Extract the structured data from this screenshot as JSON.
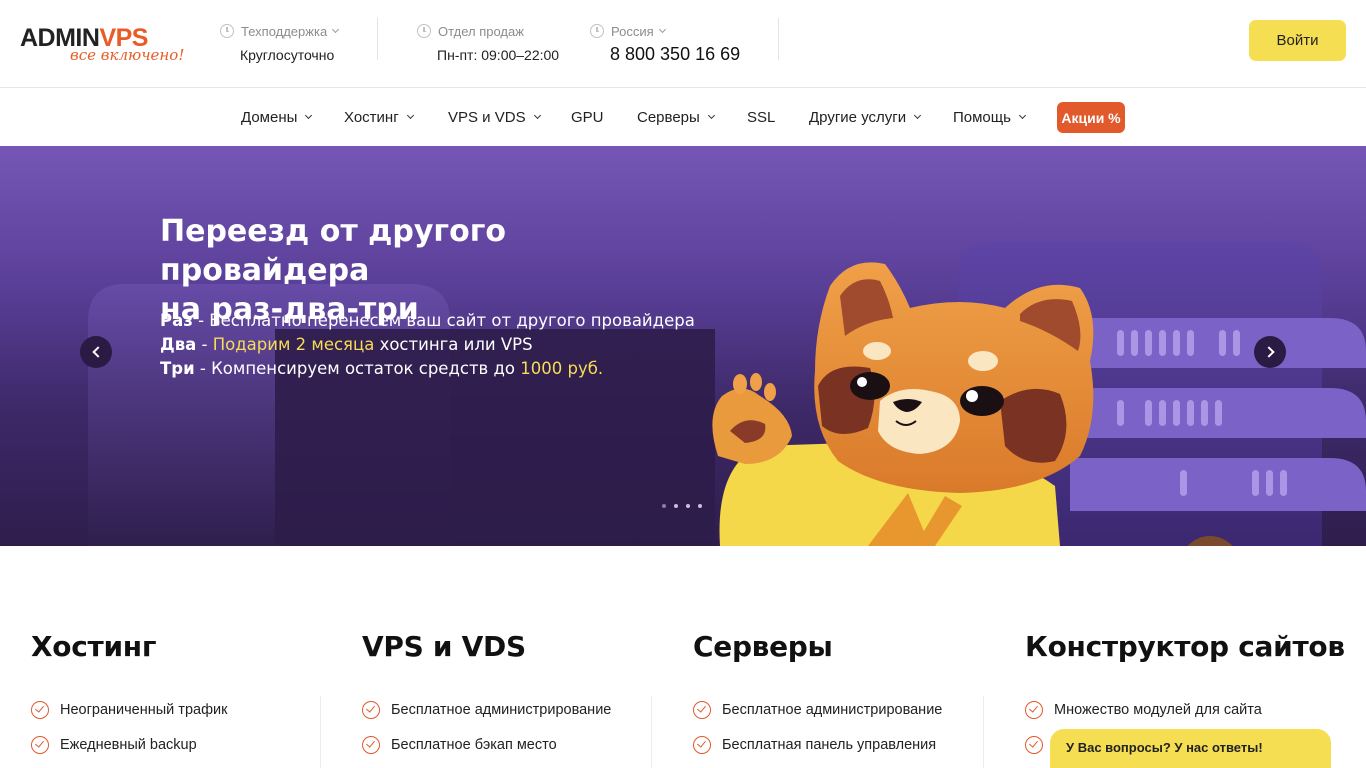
{
  "logo": {
    "brand_left": "ADMIN",
    "brand_right": "VPS",
    "tagline": "все включено!"
  },
  "header": {
    "support": {
      "label": "Техподдержка",
      "value": "Круглосуточно"
    },
    "sales": {
      "label": "Отдел продаж",
      "value": "Пн-пт: 09:00–22:00"
    },
    "region": {
      "label": "Россия",
      "phone": "8 800 350 16 69"
    },
    "login_label": "Войти"
  },
  "nav": {
    "items": [
      {
        "label": "Домены",
        "dropdown": true
      },
      {
        "label": "Хостинг",
        "dropdown": true
      },
      {
        "label": "VPS и VDS",
        "dropdown": true
      },
      {
        "label": "GPU",
        "dropdown": false
      },
      {
        "label": "Серверы",
        "dropdown": true
      },
      {
        "label": "SSL",
        "dropdown": false
      },
      {
        "label": "Другие услуги",
        "dropdown": true
      },
      {
        "label": "Помощь",
        "dropdown": true
      }
    ],
    "promo_label": "Акции %"
  },
  "hero": {
    "title_line1": "Переезд от другого провайдера",
    "title_line2": "на раз-два-три",
    "line1": {
      "lead": "Раз",
      "sep": " - ",
      "text": "Бесплатно перенесем ваш сайт от другого провайдера"
    },
    "line2": {
      "lead": "Два",
      "sep": " - ",
      "highlight": "Подарим 2 месяца",
      "text": " хостинга или VPS"
    },
    "line3": {
      "lead": "Три",
      "sep": " - ",
      "text": "Компенсируем остаток средств до ",
      "highlight": "1000 руб."
    },
    "slides_count": 4,
    "active_slide": 1
  },
  "services": [
    {
      "title": "Хостинг",
      "items": [
        "Неограниченный трафик",
        "Ежедневный backup"
      ]
    },
    {
      "title": "VPS и VDS",
      "items": [
        "Бесплатное администрирование",
        "Бесплатное бэкап место"
      ]
    },
    {
      "title": "Серверы",
      "items": [
        "Бесплатное администрирование",
        "Бесплатная панель управления"
      ]
    },
    {
      "title": "Конструктор сайтов",
      "items": [
        "Множество модулей для сайта",
        ""
      ]
    }
  ],
  "chat": {
    "label": "У Вас вопросы? У нас ответы!"
  },
  "colors": {
    "accent": "#e2592c",
    "yellow": "#f5de52",
    "hero_purple": "#5a3f98"
  }
}
